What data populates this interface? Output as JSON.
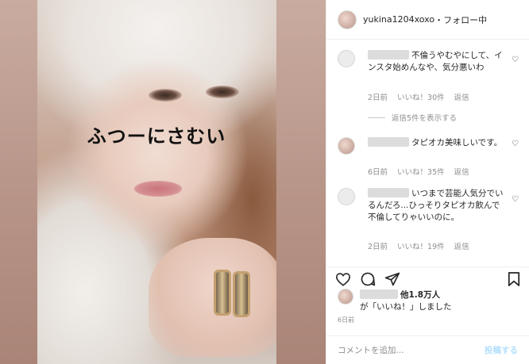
{
  "post": {
    "overlay_text": "ふつーにさむい"
  },
  "header": {
    "username": "yukina1204xoxo",
    "separator": "・",
    "follow_status": "フォロー中"
  },
  "comments": [
    {
      "text": "不倫うやむやにして、インスタ始めんなや、気分悪いわ",
      "time": "2日前",
      "likes": "いいね！30件",
      "reply": "返信"
    },
    {
      "text": "タピオカ美味しいです。",
      "time": "6日前",
      "likes": "いいね！35件",
      "reply": "返信"
    },
    {
      "text": "いつまで芸能人気分でいるんだろ...ひっそりタピオカ飲んで不倫してりゃいいのに。",
      "time": "2日前",
      "likes": "いいね！19件",
      "reply": "返信"
    }
  ],
  "view_replies": "返信5件を表示する",
  "likes_summary": {
    "others": "他1.8万人",
    "suffix": "が「いいね！」しました"
  },
  "time_ago": "6日前",
  "composer": {
    "placeholder": "コメントを追加...",
    "post_label": "投稿する"
  },
  "icons": {
    "like": "heart-icon",
    "comment": "comment-icon",
    "share": "paper-plane-icon",
    "save": "bookmark-icon"
  },
  "colors": {
    "post_button": "#b2dffc",
    "meta_text": "#8e8e8e"
  }
}
